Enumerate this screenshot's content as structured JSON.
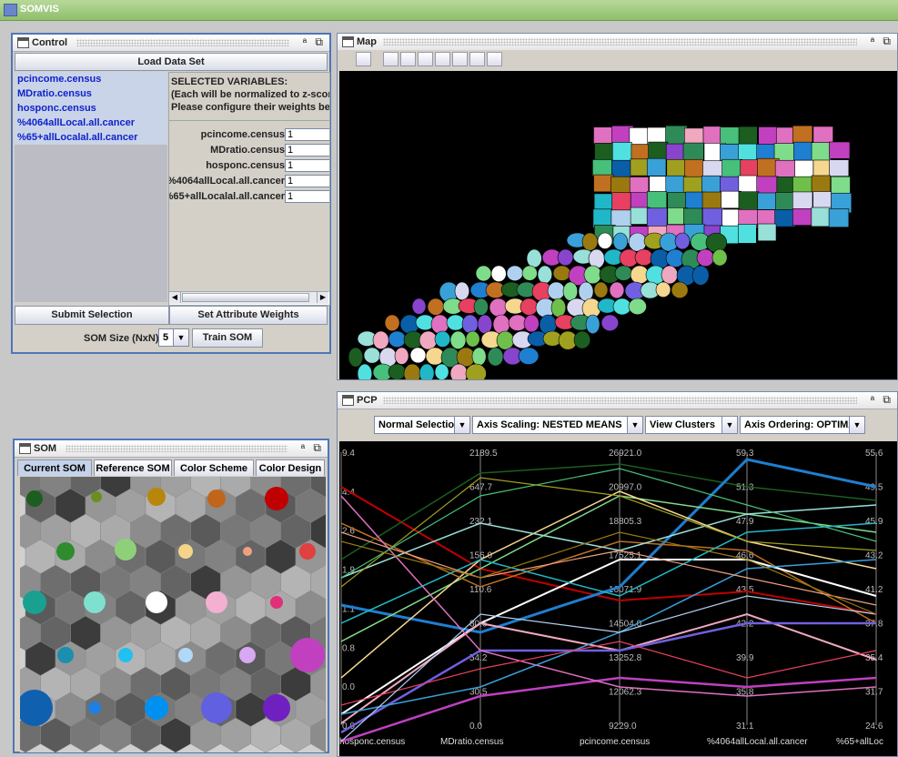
{
  "app": {
    "title": "SOMVIS"
  },
  "control": {
    "title": "Control",
    "load_button": "Load Data Set",
    "variables": [
      "pcincome.census",
      "MDratio.census",
      "hosponc.census",
      "%4064allLocal.all.cancer",
      "%65+allLocalal.all.cancer"
    ],
    "info_lines": [
      "SELECTED VARIABLES:",
      "(Each will be normalized to z-scores)",
      "Please configure their weights below"
    ],
    "weights": [
      {
        "name": "pcincome.census",
        "value": "1"
      },
      {
        "name": "MDratio.census",
        "value": "1"
      },
      {
        "name": "hosponc.census",
        "value": "1"
      },
      {
        "name": "%4064allLocal.all.cancer",
        "value": "1"
      },
      {
        "name": "%65+allLocalal.all.cancer",
        "value": "1"
      }
    ],
    "submit_button": "Submit Selection",
    "weights_button": "Set Attribute Weights",
    "som_size_label": "SOM Size (NxN):",
    "som_size_value": "5",
    "train_button": "Train SOM"
  },
  "map": {
    "title": "Map"
  },
  "som": {
    "title": "SOM",
    "tabs": [
      "Current SOM",
      "Reference SOM",
      "Color Scheme",
      "Color Design"
    ]
  },
  "pcp": {
    "title": "PCP",
    "controls": [
      "Normal Selection",
      "Axis Scaling: NESTED MEANS",
      "View Clusters",
      "Axis Ordering: OPTIMAL"
    ],
    "axes": [
      {
        "name": "hosponc.census",
        "ticks": [
          "9.4",
          "4.4",
          "2.6",
          "1.9",
          "1.1",
          "0.8",
          "0.0",
          "0.0"
        ]
      },
      {
        "name": "MDratio.census",
        "ticks": [
          "2189.5",
          "647.7",
          "232.1",
          "156.0",
          "110.6",
          "80.6",
          "54.2",
          "30.5",
          "0.0"
        ]
      },
      {
        "name": "pcincome.census",
        "ticks": [
          "26921.0",
          "20997.0",
          "18805.3",
          "17525.1",
          "16071.9",
          "14504.0",
          "13252.8",
          "12062.3",
          "9229.0"
        ]
      },
      {
        "name": "%4064allLocal.all.cancer",
        "ticks": [
          "59.3",
          "51.3",
          "47.9",
          "46.6",
          "43.5",
          "42.2",
          "39.9",
          "35.8",
          "31.1"
        ]
      },
      {
        "name": "%65+allLoc",
        "ticks": [
          "55.6",
          "49.5",
          "45.9",
          "43.2",
          "41.2",
          "37.8",
          "35.4",
          "31.7",
          "24.6"
        ]
      }
    ]
  },
  "colors": {
    "som_cells": [
      "#1b5e20",
      "#6b8e23",
      "#b8860b",
      "#c0661a",
      "#c00000",
      "#2e8b2e",
      "#8ed07a",
      "#f5d48a",
      "#f0a080",
      "#e04040",
      "#1aa090",
      "#80e0d0",
      "#ffffff",
      "#f4b0d0",
      "#e0307a",
      "#1a8fb0",
      "#20c0f0",
      "#b0d8f8",
      "#d8a8f0",
      "#c040c0",
      "#1060b0",
      "#2080e0",
      "#0090f0",
      "#6060e0",
      "#7020c0"
    ]
  }
}
